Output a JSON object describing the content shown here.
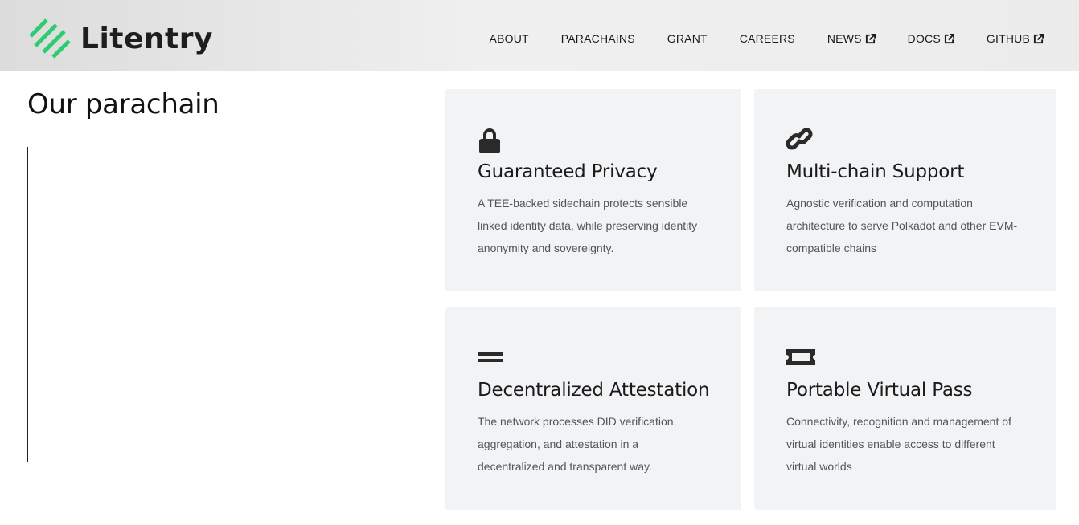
{
  "header": {
    "logo_text": "Litentry",
    "nav": [
      {
        "label": "ABOUT",
        "external": false
      },
      {
        "label": "PARACHAINS",
        "external": false
      },
      {
        "label": "GRANT",
        "external": false
      },
      {
        "label": "CAREERS",
        "external": false
      },
      {
        "label": "NEWS",
        "external": true
      },
      {
        "label": "DOCS",
        "external": true
      },
      {
        "label": "GITHUB",
        "external": true
      }
    ]
  },
  "section": {
    "title": "Our parachain"
  },
  "cards": [
    {
      "icon": "lock-icon",
      "title": "Guaranteed Privacy",
      "text": "A TEE-backed sidechain protects sensible linked identity data, while preserving identity anonymity and sovereignty."
    },
    {
      "icon": "link-icon",
      "title": "Multi-chain Support",
      "text": "Agnostic verification and computation architecture to serve Polkadot and other EVM-compatible chains"
    },
    {
      "icon": "equals-icon",
      "title": "Decentralized Attestation",
      "text": "The network processes DID verification, aggregation, and attestation in a decentralized and transparent way."
    },
    {
      "icon": "ticket-icon",
      "title": "Portable Virtual Pass",
      "text": "Connectivity, recognition and management of virtual identities enable access to different virtual worlds"
    }
  ],
  "colors": {
    "brand_green": "#2ecc71",
    "card_bg": "#f2f3f5",
    "text_dark": "#1a1a1a",
    "text_muted": "#555555"
  }
}
